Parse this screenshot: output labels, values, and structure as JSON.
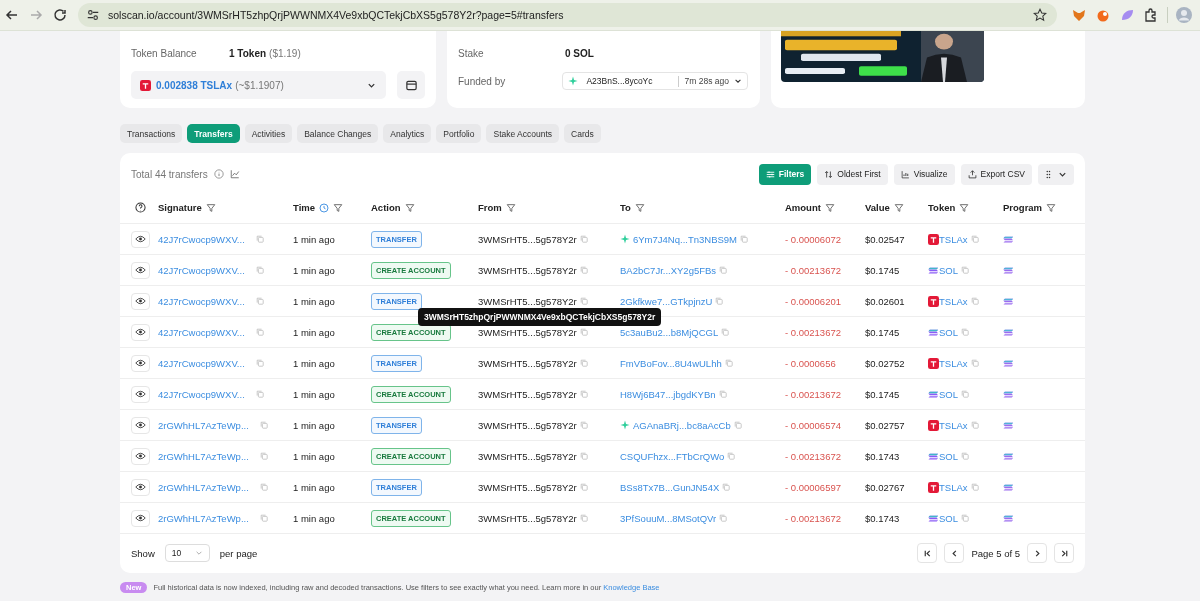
{
  "browser": {
    "url": "solscan.io/account/3WMSrHT5zhpQrjPWWNMX4Ve9xbQCTekjCbXS5g578Y2r?page=5#transfers"
  },
  "token_card": {
    "balance_label": "Token Balance",
    "balance_value": "1 Token",
    "balance_usd": "($1.19)",
    "select_amount": "0.002838 TSLAx",
    "select_usd": "(~$1.1907)"
  },
  "account_card": {
    "stake_label": "Stake",
    "stake_value": "0 SOL",
    "funded_label": "Funded by",
    "funded_address": "A23BnS...8ycoYc",
    "funded_time": "7m 28s ago"
  },
  "tabs": [
    {
      "label": "Transactions",
      "selected": false
    },
    {
      "label": "Transfers",
      "selected": true
    },
    {
      "label": "Activities",
      "selected": false
    },
    {
      "label": "Balance Changes",
      "selected": false
    },
    {
      "label": "Analytics",
      "selected": false
    },
    {
      "label": "Portfolio",
      "selected": false
    },
    {
      "label": "Stake Accounts",
      "selected": false
    },
    {
      "label": "Cards",
      "selected": false
    }
  ],
  "transfers": {
    "total": "Total 44 transfers",
    "buttons": [
      {
        "label": "Filters",
        "kind": "primary"
      },
      {
        "label": "Oldest First",
        "kind": "sort"
      },
      {
        "label": "Visualize",
        "kind": "chart"
      },
      {
        "label": "Export CSV",
        "kind": "export"
      }
    ],
    "columns": [
      {
        "label": "Signature",
        "kind": "plain"
      },
      {
        "label": "Time",
        "kind": "time"
      },
      {
        "label": "Action",
        "kind": "plain"
      },
      {
        "label": "From",
        "kind": "plain"
      },
      {
        "label": "To",
        "kind": "plain"
      },
      {
        "label": "Amount",
        "kind": "plain"
      },
      {
        "label": "Value",
        "kind": "plain"
      },
      {
        "label": "Token",
        "kind": "plain"
      },
      {
        "label": "Program",
        "kind": "plain"
      }
    ],
    "rows": [
      {
        "signature": "42J7rCwocp9WXV...",
        "time": "1 min ago",
        "action": {
          "label": "TRANSFER",
          "kind": "transfer"
        },
        "from": "3WMSrHT5...5g578Y2r",
        "to": "6Ym7J4Nq...Tn3NBS9M",
        "to_marked": true,
        "amount": "- 0.00006072",
        "value": "$0.02547",
        "token": {
          "symbol": "TSLAx",
          "kind": "tslax"
        }
      },
      {
        "signature": "42J7rCwocp9WXV...",
        "time": "1 min ago",
        "action": {
          "label": "CREATE ACCOUNT",
          "kind": "create"
        },
        "from": "3WMSrHT5...5g578Y2r",
        "to": "BA2bC7Jr...XY2g5FBs",
        "to_marked": false,
        "amount": "- 0.00213672",
        "value": "$0.1745",
        "token": {
          "symbol": "SOL",
          "kind": "sol"
        }
      },
      {
        "signature": "42J7rCwocp9WXV...",
        "time": "1 min ago",
        "action": {
          "label": "TRANSFER",
          "kind": "transfer"
        },
        "from": "3WMSrHT5...5g578Y2r",
        "tooltip": "3WMSrHT5zhpQrjPWWNMX4Ve9xbQCTekjCbXS5g578Y2r",
        "to": "2Gkfkwe7...GTkpjnzU",
        "to_marked": false,
        "amount": "- 0.00006201",
        "value": "$0.02601",
        "token": {
          "symbol": "TSLAx",
          "kind": "tslax"
        }
      },
      {
        "signature": "42J7rCwocp9WXV...",
        "time": "1 min ago",
        "action": {
          "label": "CREATE ACCOUNT",
          "kind": "create"
        },
        "from": "3WMSrHT5...5g578Y2r",
        "to": "5c3auBu2...b8MjQCGL",
        "to_marked": false,
        "amount": "- 0.00213672",
        "value": "$0.1745",
        "token": {
          "symbol": "SOL",
          "kind": "sol"
        }
      },
      {
        "signature": "42J7rCwocp9WXV...",
        "time": "1 min ago",
        "action": {
          "label": "TRANSFER",
          "kind": "transfer"
        },
        "from": "3WMSrHT5...5g578Y2r",
        "to": "FmVBoFov...8U4wULhh",
        "to_marked": false,
        "amount": "- 0.0000656",
        "value": "$0.02752",
        "token": {
          "symbol": "TSLAx",
          "kind": "tslax"
        }
      },
      {
        "signature": "42J7rCwocp9WXV...",
        "time": "1 min ago",
        "action": {
          "label": "CREATE ACCOUNT",
          "kind": "create"
        },
        "from": "3WMSrHT5...5g578Y2r",
        "to": "H8Wj6B47...jbgdKYBn",
        "to_marked": false,
        "amount": "- 0.00213672",
        "value": "$0.1745",
        "token": {
          "symbol": "SOL",
          "kind": "sol"
        }
      },
      {
        "signature": "2rGWhHL7AzTeWp...",
        "time": "1 min ago",
        "action": {
          "label": "TRANSFER",
          "kind": "transfer"
        },
        "from": "3WMSrHT5...5g578Y2r",
        "to": "AGAnaBRj...bc8aAcCb",
        "to_marked": true,
        "amount": "- 0.00006574",
        "value": "$0.02757",
        "token": {
          "symbol": "TSLAx",
          "kind": "tslax"
        }
      },
      {
        "signature": "2rGWhHL7AzTeWp...",
        "time": "1 min ago",
        "action": {
          "label": "CREATE ACCOUNT",
          "kind": "create"
        },
        "from": "3WMSrHT5...5g578Y2r",
        "to": "CSQUFhzx...FTbCrQWo",
        "to_marked": false,
        "amount": "- 0.00213672",
        "value": "$0.1743",
        "token": {
          "symbol": "SOL",
          "kind": "sol"
        }
      },
      {
        "signature": "2rGWhHL7AzTeWp...",
        "time": "1 min ago",
        "action": {
          "label": "TRANSFER",
          "kind": "transfer"
        },
        "from": "3WMSrHT5...5g578Y2r",
        "to": "BSs8Tx7B...GunJN54X",
        "to_marked": false,
        "amount": "- 0.00006597",
        "value": "$0.02767",
        "token": {
          "symbol": "TSLAx",
          "kind": "tslax"
        }
      },
      {
        "signature": "2rGWhHL7AzTeWp...",
        "time": "1 min ago",
        "action": {
          "label": "CREATE ACCOUNT",
          "kind": "create"
        },
        "from": "3WMSrHT5...5g578Y2r",
        "to": "3PfSouuM...8MSotQVr",
        "to_marked": false,
        "amount": "- 0.00213672",
        "value": "$0.1743",
        "token": {
          "symbol": "SOL",
          "kind": "sol"
        }
      }
    ],
    "pagination": {
      "show_label": "Show",
      "per_page_value": "10",
      "per_page_label": "per page",
      "page": "Page 5 of 5"
    }
  },
  "notice": {
    "badge": "New",
    "text": "Full historical data is now indexed, including raw and decoded transactions. Use filters to see exactly what you need. Learn more in our",
    "link": "Knowledge Base"
  }
}
